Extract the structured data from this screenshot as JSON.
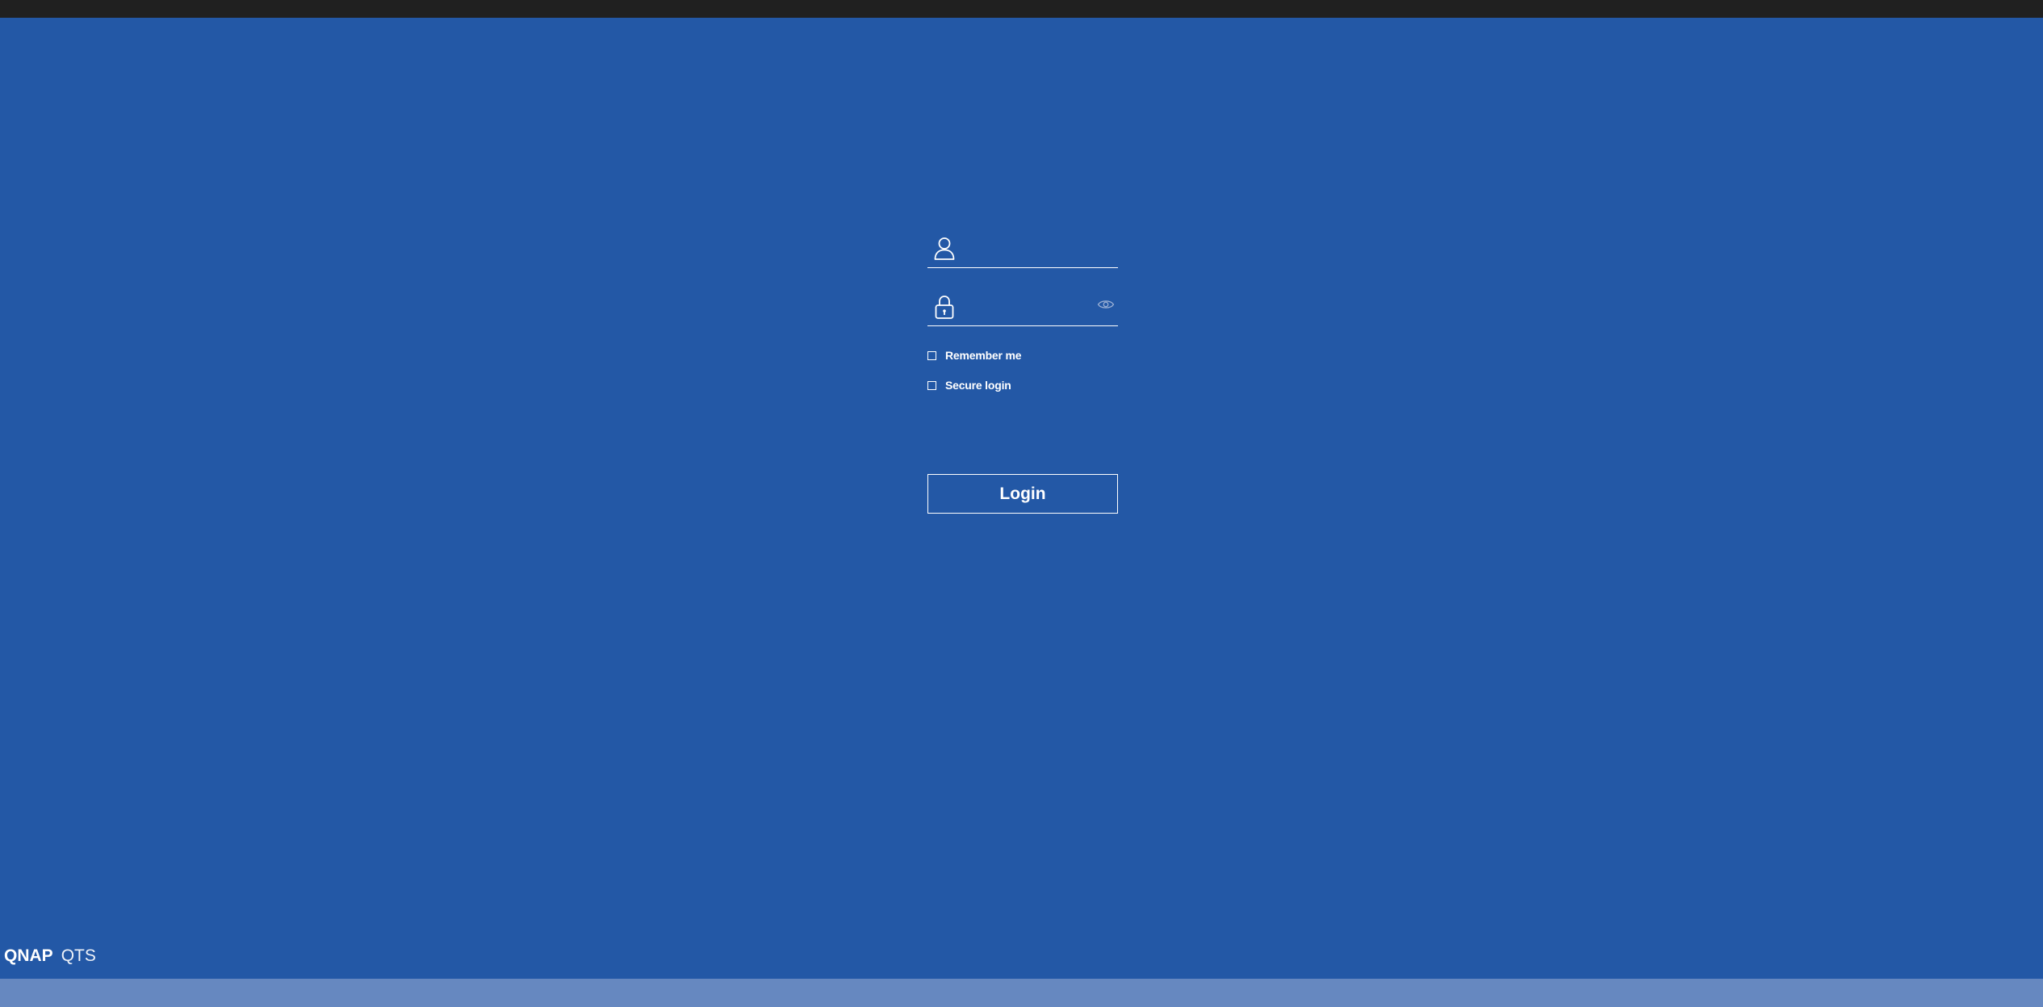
{
  "login": {
    "username": {
      "icon": "user-icon",
      "value": "",
      "placeholder": ""
    },
    "password": {
      "icon": "lock-icon",
      "value": "",
      "placeholder": "",
      "toggle_icon": "eye-icon"
    },
    "options": {
      "remember_me": {
        "label": "Remember me",
        "checked": false
      },
      "secure_login": {
        "label": "Secure login",
        "checked": false
      }
    },
    "button_label": "Login"
  },
  "footer": {
    "brand": "QNAP",
    "product": "QTS"
  },
  "colors": {
    "background": "#2358a6",
    "top_bar": "#202020",
    "bottom_bar": "#6688c0",
    "foreground": "#ffffff"
  }
}
